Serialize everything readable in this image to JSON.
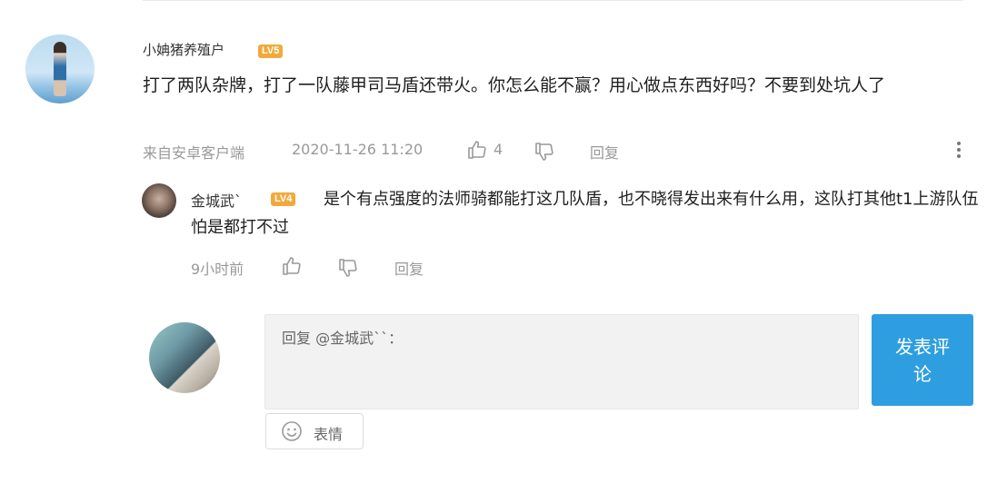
{
  "comment": {
    "username": "小姌猪养殖户",
    "level_badge": "LV5",
    "text": "打了两队杂牌，打了一队藤甲司马盾还带火。你怎么能不赢？用心做点东西好吗？不要到处坑人了",
    "source": "来自安卓客户端",
    "timestamp": "2020-11-26 11:20",
    "like_count": "4",
    "reply_label": "回复"
  },
  "reply": {
    "username": "金城武`",
    "level_badge": "LV4",
    "text": "是个有点强度的法师骑都能打这几队盾，也不晓得发出来有什么用，这队打其他t1上游队伍怕是都打不过",
    "time": "9小时前",
    "reply_label": "回复"
  },
  "composer": {
    "placeholder": "回复 @金城武``：",
    "submit_label": "发表评论",
    "emoji_label": "表情"
  },
  "colors": {
    "accent": "#2f9ee0",
    "badge": "#f2a93b"
  }
}
